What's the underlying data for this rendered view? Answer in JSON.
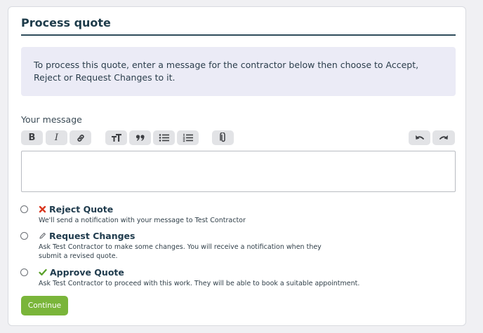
{
  "card": {
    "title": "Process quote",
    "info_text": "To process this quote, enter a message for the contractor below then choose to Accept, Reject or Request Changes to it."
  },
  "message": {
    "label": "Your message",
    "value": ""
  },
  "toolbar": {
    "bold": "B",
    "italic": "I"
  },
  "options": [
    {
      "title": "Reject Quote",
      "icon": "cross-icon",
      "icon_color": "#d9371f",
      "description": "We'll send a notification with your message to Test Contractor",
      "selected": false
    },
    {
      "title": "Request Changes",
      "icon": "pencil-icon",
      "icon_color": "#7a7d82",
      "description": "Ask Test Contractor to make some changes. You will receive a notification when they submit a revised quote.",
      "selected": false
    },
    {
      "title": "Approve Quote",
      "icon": "check-icon",
      "icon_color": "#5aa12b",
      "description": "Ask Test Contractor to proceed with this work. They will be able to book a suitable appointment.",
      "selected": false
    }
  ],
  "actions": {
    "continue_label": "Continue"
  },
  "colors": {
    "accent_button": "#7ab53a",
    "heading": "#1d3b4a",
    "info_background": "#ebebf6"
  }
}
